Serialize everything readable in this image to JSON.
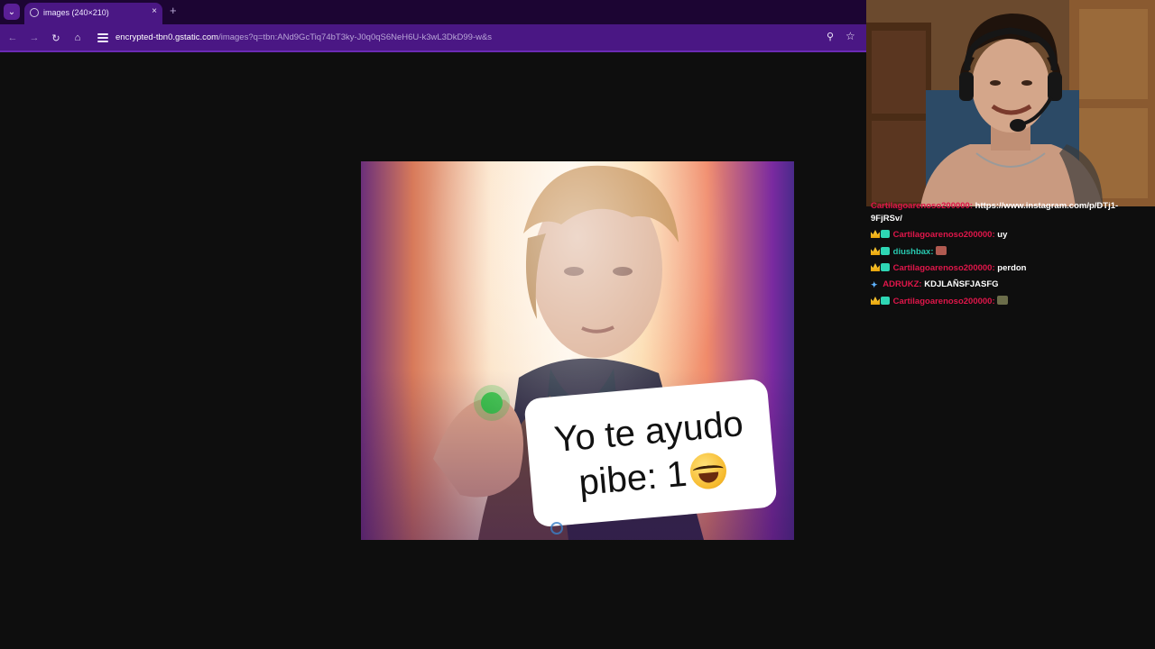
{
  "browser": {
    "tab_title": "images (240×210)",
    "new_tab_symbol": "+",
    "tab_close_symbol": "×",
    "url_host": "encrypted-tbn0.gstatic.com",
    "url_path": "/images?q=tbn:ANd9GcTiq74bT3ky-J0q0qS6NeH6U-k3wL3DkD99-w&s",
    "icons": [
      "tab-menu-icon",
      "back-icon",
      "forward-icon",
      "reload-icon",
      "home-icon",
      "site-info-icon",
      "zoom-icon",
      "star-icon"
    ]
  },
  "meme": {
    "caption_line1": "Yo te ayudo",
    "caption_line2": "pibe: 1",
    "emoji": "laughing-face-emoji"
  },
  "chat": {
    "messages": [
      {
        "user": "Cartilagoarenoso200000:",
        "text": "https://www.instagram.com/p/DTj1-",
        "badges": [
          "crown",
          "sub"
        ]
      },
      {
        "user": "",
        "text": "9FjRSv/",
        "badges": []
      },
      {
        "user": "Cartilagoarenoso200000:",
        "text": "uy",
        "badges": [
          "crown",
          "sub"
        ]
      },
      {
        "user": "diushbax:",
        "text": "",
        "badges": [
          "crown",
          "sub"
        ],
        "emote": "red-emote"
      },
      {
        "user": "Cartilagoarenoso200000:",
        "text": "perdon",
        "badges": [
          "crown",
          "sub"
        ]
      },
      {
        "user": "ADRUKZ:",
        "text": "KDJLAÑSFJASFG",
        "badges": [
          "sword"
        ]
      },
      {
        "user": "Cartilagoarenoso200000:",
        "text": "",
        "badges": [
          "crown",
          "sub"
        ],
        "emote": "green-emote"
      }
    ]
  },
  "colors": {
    "tab_strip": "#1c0533",
    "toolbar": "#4a1784",
    "chat_user_red": "#e0164a",
    "chat_user_teal": "#28c9b0"
  }
}
